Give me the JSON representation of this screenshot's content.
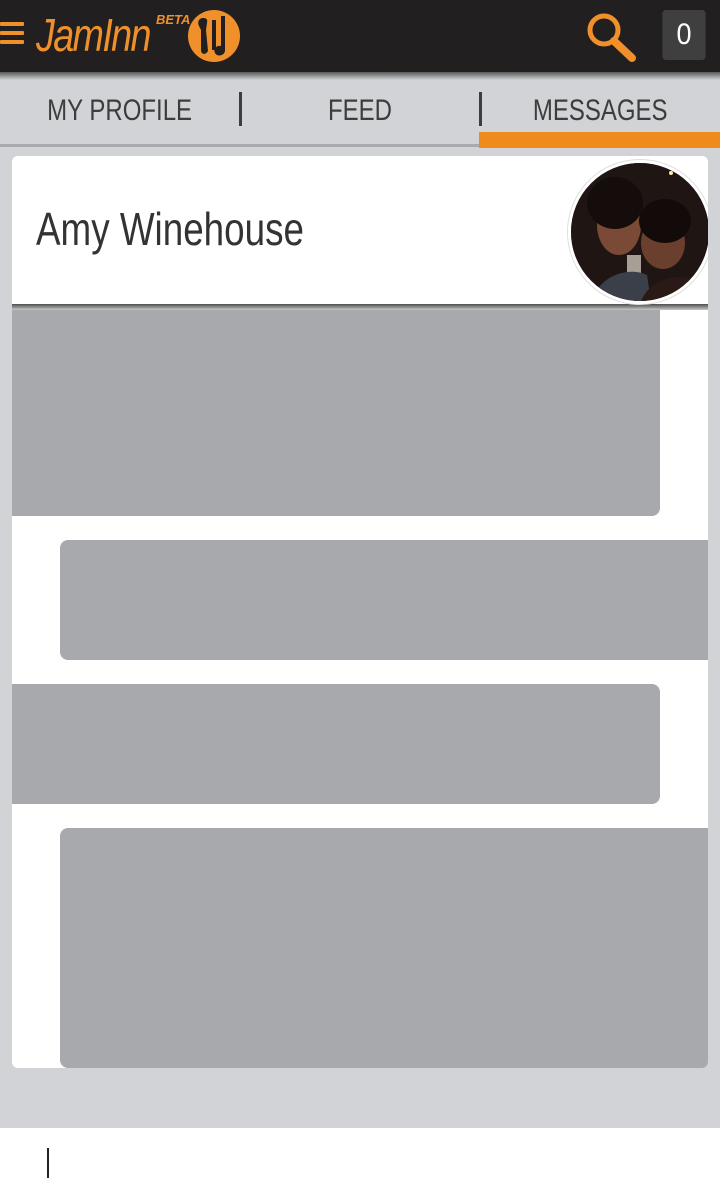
{
  "header": {
    "logo_text": "JamInn",
    "beta_label": "BETA",
    "notification_count": "0",
    "accent_color": "#f0902a",
    "icons": [
      "menu-icon",
      "guitar-logo-icon",
      "search-icon"
    ]
  },
  "tabs": [
    {
      "label": "MY PROFILE",
      "active": false
    },
    {
      "label": "FEED",
      "active": false
    },
    {
      "label": "MESSAGES",
      "active": true
    }
  ],
  "conversation": {
    "contact_name": "Amy Winehouse",
    "avatar": "contact-avatar-photo",
    "messages": [
      {
        "direction": "incoming"
      },
      {
        "direction": "outgoing"
      },
      {
        "direction": "incoming"
      },
      {
        "direction": "outgoing"
      }
    ]
  },
  "compose": {
    "value": "",
    "placeholder": ""
  }
}
